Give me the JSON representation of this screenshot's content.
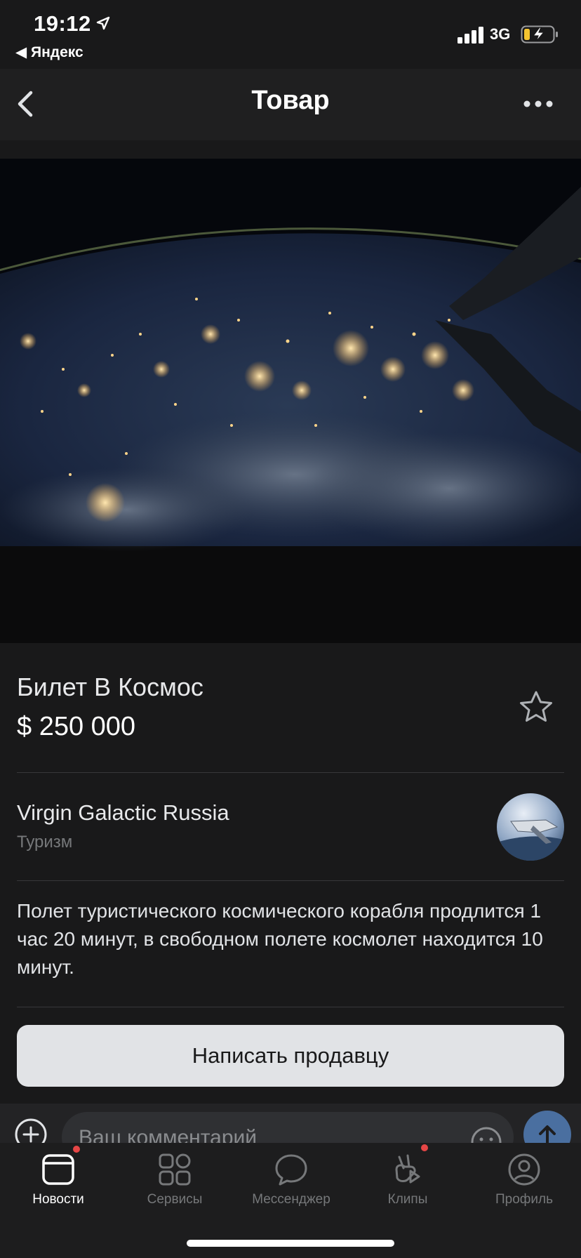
{
  "status_bar": {
    "time": "19:12",
    "back_app": "◀ Яндекс",
    "network": "3G"
  },
  "header": {
    "title": "Товар"
  },
  "product": {
    "title": "Билет В Космос",
    "price": "$ 250 000"
  },
  "seller": {
    "name": "Virgin Galactic Russia",
    "category": "Туризм"
  },
  "description": "Полет туристического космического корабля продлится 1 час 20 минут, в свободном полете космолет находится 10 минут.",
  "actions": {
    "write_seller": "Написать продавцу"
  },
  "comment": {
    "placeholder": "Ваш комментарий"
  },
  "tabs": [
    {
      "label": "Новости",
      "icon": "news-icon",
      "active": true,
      "badge": true
    },
    {
      "label": "Сервисы",
      "icon": "services-icon",
      "active": false,
      "badge": false
    },
    {
      "label": "Мессенджер",
      "icon": "messenger-icon",
      "active": false,
      "badge": false
    },
    {
      "label": "Клипы",
      "icon": "clips-icon",
      "active": false,
      "badge": true
    },
    {
      "label": "Профиль",
      "icon": "profile-icon",
      "active": false,
      "badge": false
    }
  ],
  "colors": {
    "background": "#19191a",
    "accent_send": "#4a6fa0",
    "badge": "#e64646",
    "button_bg": "#e1e3e6"
  }
}
